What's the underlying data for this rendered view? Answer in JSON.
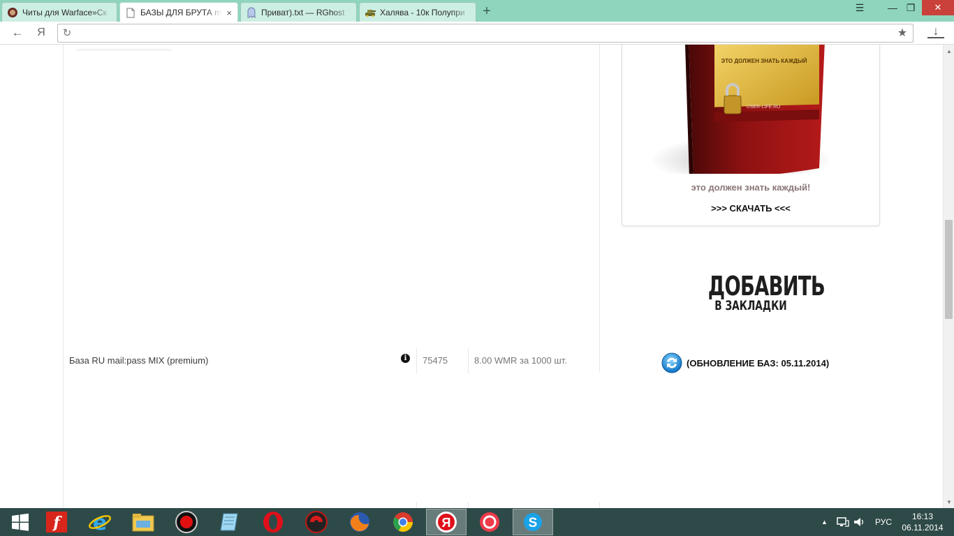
{
  "tabs": [
    {
      "title": "Читы для Warface»Ск",
      "icon": "warface-favicon",
      "active": false,
      "close": "×"
    },
    {
      "title": "БАЗЫ ДЛЯ БРУТА mai",
      "icon": "page-favicon",
      "active": true,
      "close": "×"
    },
    {
      "title": "Приват).txt — RGhost",
      "icon": "rghost-favicon",
      "active": false,
      "close": "×"
    },
    {
      "title": "Халява - 10к Полупри",
      "icon": "tank-favicon",
      "active": false,
      "close": "×"
    }
  ],
  "new_tab_label": "+",
  "window_controls": {
    "menu": "☰",
    "minimize": "—",
    "restore": "❐",
    "close": "✕"
  },
  "toolbar": {
    "back": "←",
    "yandex": "Я",
    "reload": "↻",
    "url": "",
    "star": "★",
    "download": "↓"
  },
  "table": {
    "row": {
      "name": "База RU mail:pass MIX (premium)",
      "info": "i",
      "count": "75475",
      "price": "8.00 WMR за 1000 шт."
    }
  },
  "ad": {
    "box_screen_text": "ЭТО ДОЛЖЕН ЗНАТЬ КАЖДЫЙ",
    "box_brand": "USER-LIFE.RU",
    "caption": "это должен знать каждый!",
    "link": ">>> СКАЧАТЬ <<<"
  },
  "bookmark": {
    "line1": "ДОБАВИТЬ",
    "line2": "В ЗАКЛАДКИ"
  },
  "update": {
    "text": "(ОБНОВЛЕНИЕ БАЗ: 05.11.2014)"
  },
  "taskbar": {
    "apps": [
      {
        "name": "windows-start-icon"
      },
      {
        "name": "flash-icon"
      },
      {
        "name": "internet-explorer-icon"
      },
      {
        "name": "file-explorer-icon"
      },
      {
        "name": "record-icon"
      },
      {
        "name": "notepad-icon"
      },
      {
        "name": "opera-icon"
      },
      {
        "name": "garena-icon"
      },
      {
        "name": "firefox-icon"
      },
      {
        "name": "chrome-icon"
      },
      {
        "name": "yandex-icon",
        "active": true
      },
      {
        "name": "red-circle-app-icon"
      },
      {
        "name": "skype-icon",
        "active": true
      }
    ],
    "tray_arrow": "▲",
    "language": "РУС",
    "time": "16:13",
    "date": "06.11.2014"
  },
  "colors": {
    "tabstrip": "#8fd5bd",
    "taskbar": "#2e4a48",
    "ad_caption": "#8a7676",
    "close_button": "#c9413a"
  }
}
